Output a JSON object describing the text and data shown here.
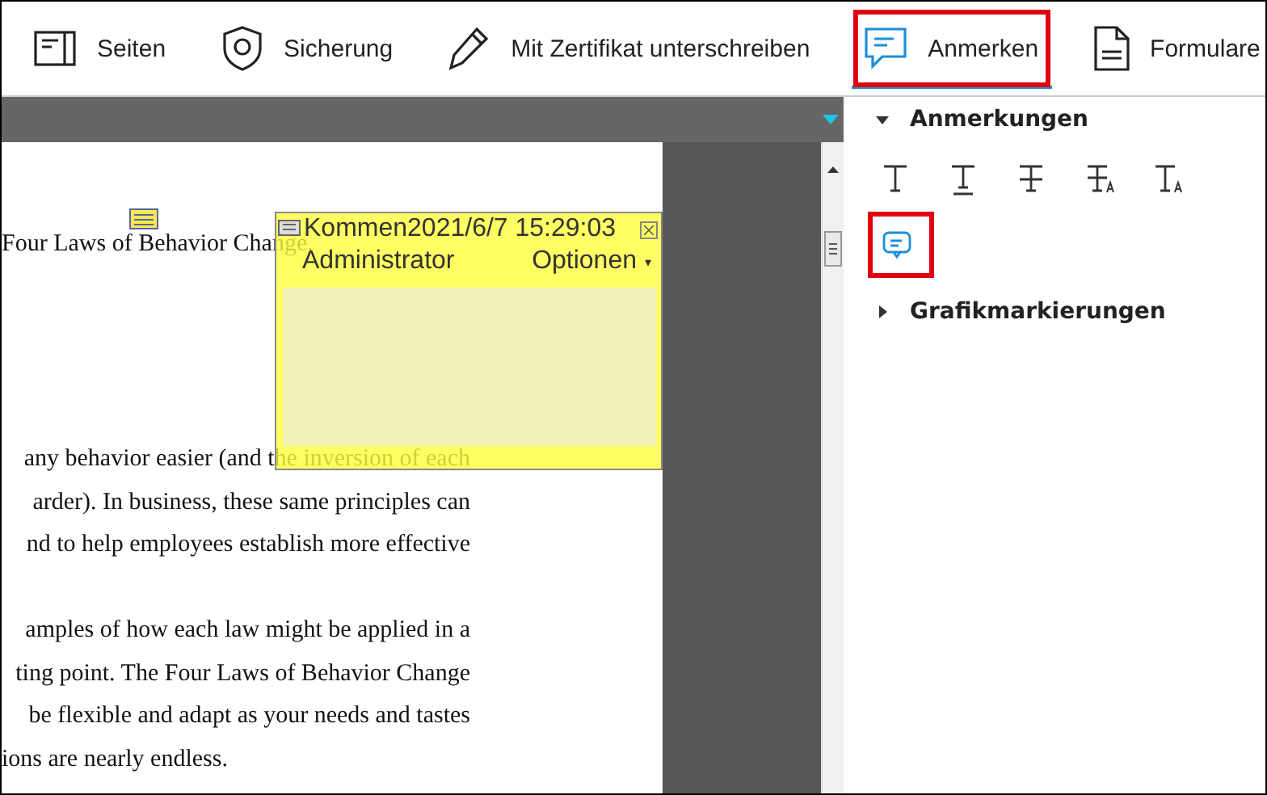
{
  "toolbar": {
    "items": [
      {
        "label": "Seiten",
        "selected": false,
        "highlighted": false
      },
      {
        "label": "Sicherung",
        "selected": false,
        "highlighted": false
      },
      {
        "label": "Mit Zertifikat unterschreiben",
        "selected": false,
        "highlighted": false
      },
      {
        "label": "Anmerken",
        "selected": true,
        "highlighted": true
      },
      {
        "label": "Formulare",
        "selected": false,
        "highlighted": false
      }
    ]
  },
  "document": {
    "paragraphs": [
      [
        "Four Laws of Behavior Change."
      ],
      [
        "any behavior easier (and the inversion of each",
        "arder). In business, these same principles can",
        "nd to help employees establish more effective"
      ],
      [
        "amples of how each law might be applied in a",
        "ting point. The Four Laws of Behavior Change",
        " be flexible and adapt as your needs and tastes",
        "ions are nearly endless."
      ]
    ],
    "comment_popup": {
      "title": "Kommen2021/6/7 15:29:03",
      "author": "Administrator",
      "options": "Optionen",
      "caret": "▾"
    }
  },
  "panel": {
    "sections": [
      {
        "title": "Anmerkungen",
        "expanded": true,
        "tools": [
          {
            "kind": "text",
            "highlighted": false
          },
          {
            "kind": "underline",
            "highlighted": false
          },
          {
            "kind": "strikeout",
            "highlighted": false
          },
          {
            "kind": "replace",
            "highlighted": false
          },
          {
            "kind": "insert",
            "highlighted": false
          },
          {
            "kind": "note",
            "highlighted": true
          }
        ]
      },
      {
        "title": "Grafikmarkierungen",
        "expanded": false
      }
    ]
  }
}
